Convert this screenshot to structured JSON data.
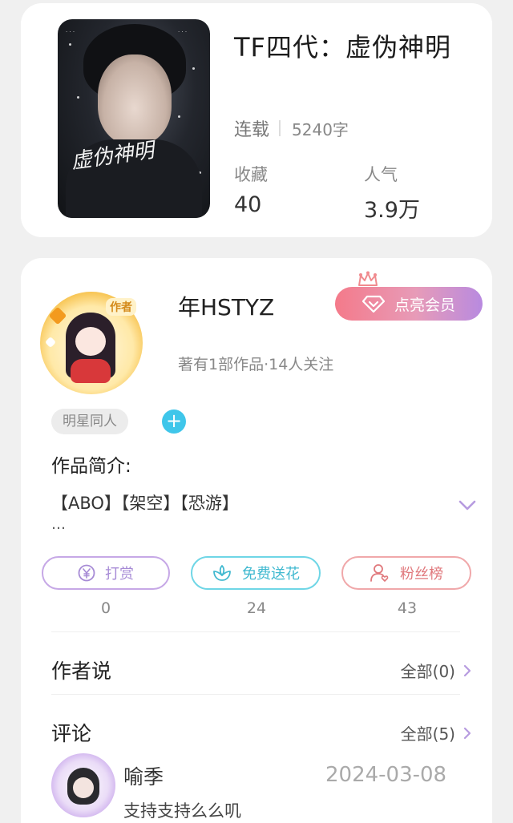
{
  "book": {
    "title": "TF四代：虚伪神明",
    "status": "连载",
    "word_count": "5240字",
    "collect_label": "收藏",
    "collect_value": "40",
    "popularity_label": "人气",
    "popularity_value": "3.9万",
    "cover_text": "虚伪神明"
  },
  "author": {
    "name": "年HSTYZ",
    "badge": "作者",
    "meta": "著有1部作品·14人关注",
    "vip_label": "点亮会员",
    "tag": "明星同人",
    "add_tag": "+"
  },
  "intro": {
    "label": "作品简介:",
    "text": "【ABO】【架空】【恐游】",
    "more": "…"
  },
  "actions": [
    {
      "label": "打赏",
      "count": "0",
      "icon": "yen-icon"
    },
    {
      "label": "免费送花",
      "count": "24",
      "icon": "flower-icon"
    },
    {
      "label": "粉丝榜",
      "count": "43",
      "icon": "fans-icon"
    }
  ],
  "author_says": {
    "title": "作者说",
    "link": "全部(0)"
  },
  "comments": {
    "title": "评论",
    "link": "全部(5)",
    "items": [
      {
        "user": "喻季",
        "date": "2024-03-08",
        "text": "支持支持么么叽"
      }
    ]
  },
  "colors": {
    "vip_start": "#f47a8a",
    "vip_end": "#b88ae0",
    "tip": "#a78bd6",
    "flower": "#41b9d0",
    "fans": "#e0787c",
    "add": "#3fc6ea"
  }
}
